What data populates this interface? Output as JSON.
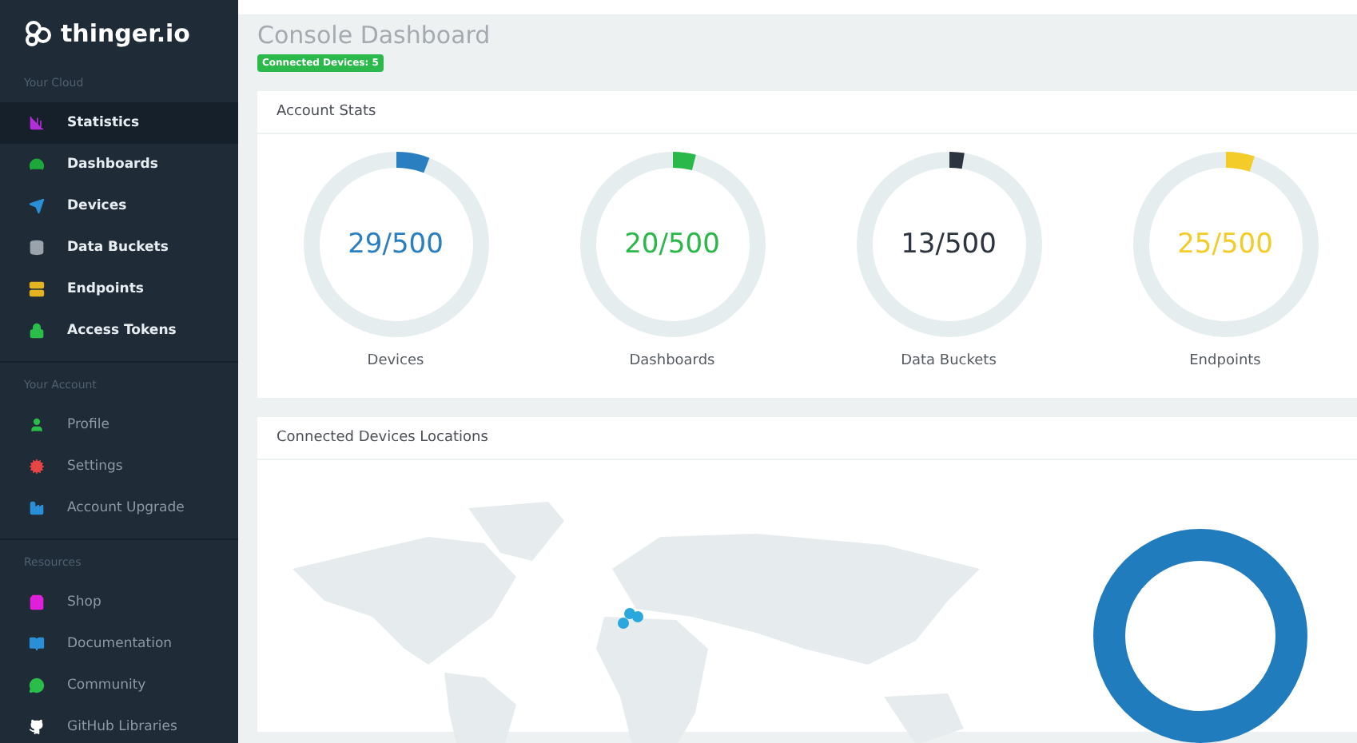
{
  "brand": "thinger.io",
  "sidebar": {
    "sections": [
      {
        "title": "Your Cloud",
        "bold": true,
        "items": [
          {
            "label": "Statistics",
            "color": "#b12fd6",
            "selected": true
          },
          {
            "label": "Dashboards",
            "color": "#1ea83c",
            "selected": false
          },
          {
            "label": "Devices",
            "color": "#2a8fd6",
            "selected": false
          },
          {
            "label": "Data Buckets",
            "color": "#9aa3ab",
            "selected": false
          },
          {
            "label": "Endpoints",
            "color": "#e3b320",
            "selected": false
          },
          {
            "label": "Access Tokens",
            "color": "#2bbd4a",
            "selected": false
          }
        ]
      },
      {
        "title": "Your Account",
        "bold": false,
        "items": [
          {
            "label": "Profile",
            "color": "#2bbd4a",
            "selected": false
          },
          {
            "label": "Settings",
            "color": "#e84545",
            "selected": false
          },
          {
            "label": "Account Upgrade",
            "color": "#2a8fd6",
            "selected": false
          }
        ]
      },
      {
        "title": "Resources",
        "bold": false,
        "items": [
          {
            "label": "Shop",
            "color": "#e020d8",
            "selected": false
          },
          {
            "label": "Documentation",
            "color": "#2a8fd6",
            "selected": false
          },
          {
            "label": "Community",
            "color": "#2bbd4a",
            "selected": false
          },
          {
            "label": "GitHub Libraries",
            "color": "#ffffff",
            "selected": false
          }
        ]
      }
    ]
  },
  "page": {
    "title": "Console Dashboard",
    "badge": "Connected Devices: 5"
  },
  "account_stats": {
    "title": "Account Stats",
    "stats": [
      {
        "value": "29/500",
        "label": "Devices",
        "level": 0.058,
        "color": "#2a7fc0"
      },
      {
        "value": "20/500",
        "label": "Dashboards",
        "level": 0.04,
        "color": "#2bb84a"
      },
      {
        "value": "13/500",
        "label": "Data Buckets",
        "level": 0.026,
        "color": "#2c3440"
      },
      {
        "value": "25/500",
        "label": "Endpoints",
        "level": 0.05,
        "color": "#f4cc2a"
      }
    ]
  },
  "locations": {
    "title": "Connected Devices Locations"
  }
}
